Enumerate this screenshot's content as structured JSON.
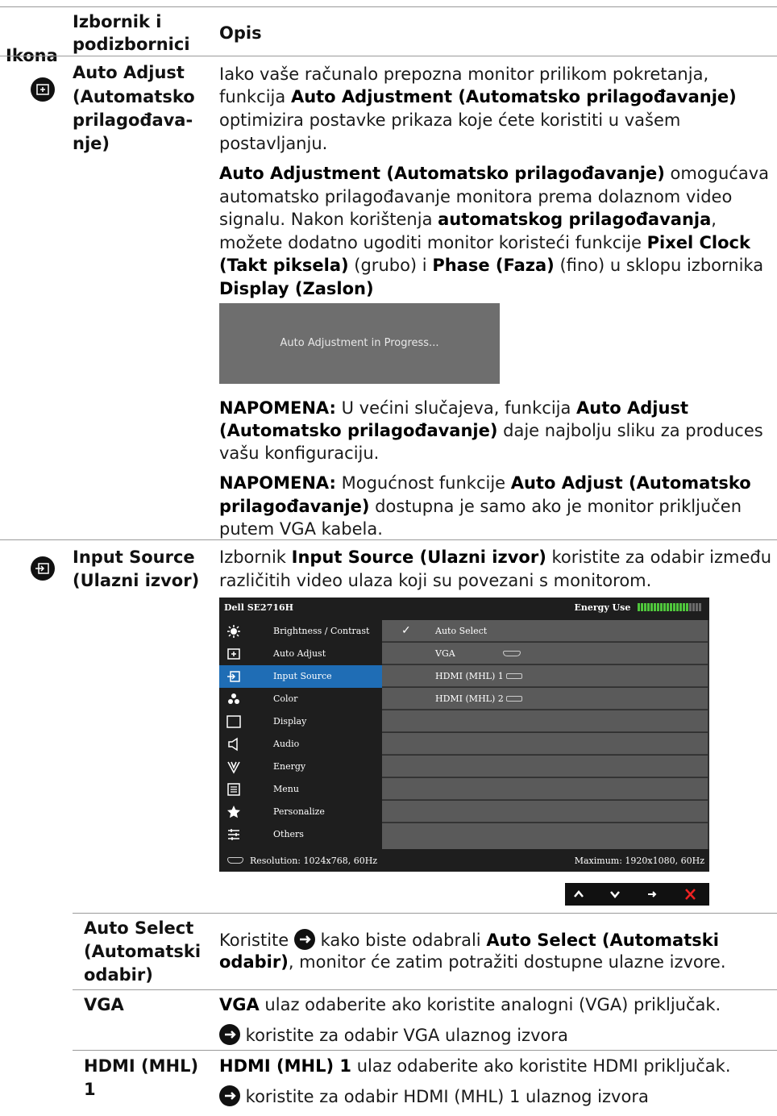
{
  "header": {
    "col_icon": "Ikona",
    "col_menu_line1": "Izbornik i",
    "col_menu_line2": "podizbornici",
    "col_desc": "Opis"
  },
  "auto_adjust": {
    "title_lines": [
      "Auto Adjust",
      "(Automatsko",
      "prilagođava-",
      "nje)"
    ],
    "para1": {
      "l1": "Iako vaše računalo prepozna monitor prilikom pokretanja,",
      "l2a": "funkcija ",
      "l2b": "Auto Adjustment (Automatsko prilagođavanje)",
      "l3": "optimizira postavke prikaza koje ćete koristiti u vašem",
      "l4": "postavljanju."
    },
    "para2": {
      "l1a": "Auto Adjustment (Automatsko prilagođavanje)",
      "l1b": " omogućava",
      "l2": "automatsko prilagođavanje monitora prema dolaznom video",
      "l3a": "signalu. Nakon korištenja ",
      "l3b": "automatskog prilagođavanja",
      "l3c": ",",
      "l4a": "možete dodatno ugoditi monitor koristeći funkcije ",
      "l4b": "Pixel Clock",
      "l5a": "(Takt piksela)",
      "l5b": " (grubo) i ",
      "l5c": "Phase (Faza)",
      "l5d": " (fino) u sklopu izbornika",
      "l6": "Display (Zaslon)"
    },
    "banner_text": "Auto Adjustment in Progress...",
    "note1": {
      "l1a": "NAPOMENA:",
      "l1b": " U većini slučajeva, funkcija ",
      "l1c": "Auto Adjust",
      "l2a": "(Automatsko prilagođavanje)",
      "l2b": " daje najbolju sliku za produces",
      "l3": "vašu konfiguraciju."
    },
    "note2": {
      "l1a": "NAPOMENA:",
      "l1b": " Mogućnost funkcije ",
      "l1c": "Auto Adjust (Automatsko",
      "l2a": "prilagođavanje)",
      "l2b": " dostupna je samo ako je monitor priključen",
      "l3": "putem VGA kabela."
    }
  },
  "input_source": {
    "title_lines": [
      "Input Source",
      "(Ulazni izvor)"
    ],
    "desc": {
      "l1a": "Izbornik ",
      "l1b": "Input Source (Ulazni izvor)",
      "l1c": " koristite za odabir između",
      "l2": "različitih video ulaza koji su povezani s monitorom."
    },
    "osd": {
      "model": "Dell SE2716H",
      "energy_label": "Energy Use",
      "energy_level": 0.8,
      "menu": [
        {
          "label": "Brightness / Contrast",
          "icon": "brightness-icon"
        },
        {
          "label": "Auto Adjust",
          "icon": "auto-adjust-icon"
        },
        {
          "label": "Input Source",
          "icon": "input-source-icon"
        },
        {
          "label": "Color",
          "icon": "color-icon"
        },
        {
          "label": "Display",
          "icon": "display-icon"
        },
        {
          "label": "Audio",
          "icon": "audio-icon"
        },
        {
          "label": "Energy",
          "icon": "energy-icon"
        },
        {
          "label": "Menu",
          "icon": "menu-icon"
        },
        {
          "label": "Personalize",
          "icon": "star-icon"
        },
        {
          "label": "Others",
          "icon": "others-icon"
        }
      ],
      "selected_index": 2,
      "options": [
        {
          "label": "Auto Select",
          "checked": true
        },
        {
          "label": "VGA",
          "port": "vga"
        },
        {
          "label": "HDMI (MHL) 1",
          "port": "hdmi"
        },
        {
          "label": "HDMI (MHL) 2",
          "port": "hdmi"
        }
      ],
      "resolution": "Resolution: 1024x768, 60Hz",
      "maximum": "Maximum: 1920x1080, 60Hz"
    },
    "nav_buttons": [
      "^",
      "v",
      "→",
      "✕"
    ]
  },
  "sub": {
    "auto_select": {
      "title_lines": [
        "Auto Select",
        "(Automatski",
        "odabir)"
      ],
      "l1a": "Koristite ",
      "l1b": " kako biste odabrali ",
      "l1c": "Auto Select (Automatski",
      "l2a": "odabir)",
      "l2b": ", monitor će zatim potražiti dostupne ulazne izvore."
    },
    "vga": {
      "title": "VGA",
      "l1a": "VGA",
      "l1b": " ulaz odaberite ako koristite analogni (VGA) priključak.",
      "l2": " koristite za odabir VGA ulaznog izvora"
    },
    "hdmi1": {
      "title_lines": [
        "HDMI (MHL)",
        "1"
      ],
      "l1a": "HDMI (MHL) 1",
      "l1b": " ulaz odaberite ako koristite HDMI priključak.",
      "l2": " koristite za odabir HDMI (MHL) 1 ulaznog izvora"
    }
  }
}
